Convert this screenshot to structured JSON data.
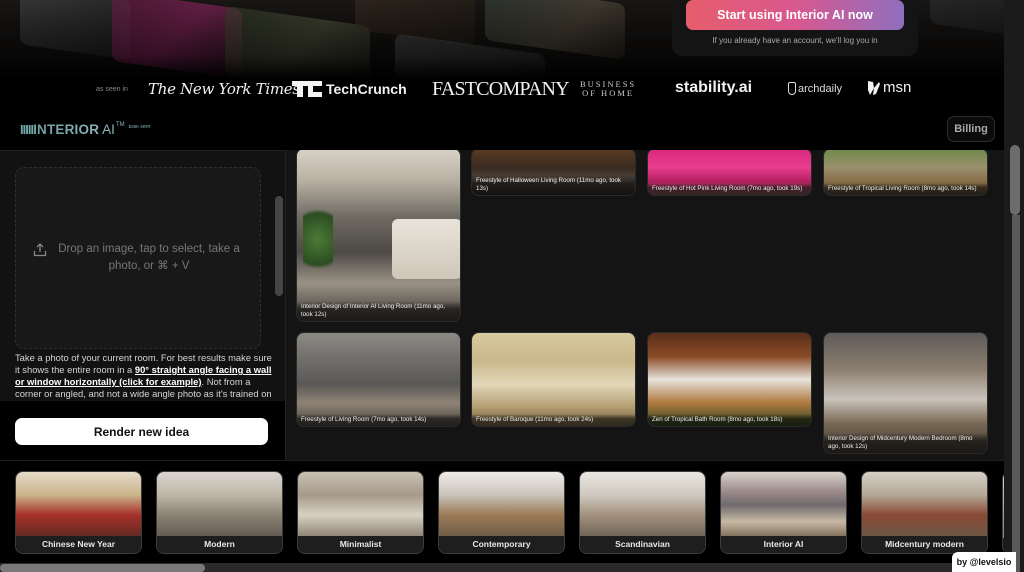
{
  "cta": {
    "button_label": "Start using Interior AI now",
    "note": "If you already have an account, we'll log you in"
  },
  "press": {
    "label": "as seen in",
    "logos": [
      "The New York Times",
      "TechCrunch",
      "FAST COMPANY",
      "BUSINESS OF HOME",
      "stability.ai",
      "archdaily",
      "msn"
    ],
    "nyt": "The New York Times",
    "techcrunch": "TechCrunch",
    "fastcompany": "FASTCOMPANY",
    "boh_line1": "BUSINESS",
    "boh_line2": "OF HOME",
    "stability": "stability.ai",
    "archdaily": "archdaily",
    "msn": "msn"
  },
  "brand": {
    "bars": "IIIII",
    "name": "INTERIOR",
    "ai": "AI",
    "tm": "TM",
    "mrr": "$38K MRR"
  },
  "header": {
    "billing_label": "Billing"
  },
  "upload": {
    "dropzone_text": "Drop an image, tap to select, take a photo, or ⌘ + V",
    "instructions_pre": "Take a photo of your current room. For best results make sure it shows the entire room in a ",
    "instructions_link": "90° straight angle facing a wall or window horizontally (click for example)",
    "instructions_post": ". Not from a corner or angled, and not a wide angle photo as it's trained on regular photos. The AI isn't great at angled pics",
    "render_label": "Render new idea"
  },
  "gallery": {
    "items": [
      {
        "caption": "Interior Design of Interior AI Living Room (11mo ago, took 12s)"
      },
      {
        "caption": "Freestyle of Halloween Living Room (11mo ago, took 13s)"
      },
      {
        "caption": "Freestyle of Hot Pink Living Room (7mo ago, took 19s)"
      },
      {
        "caption": "Freestyle of Tropical Living Room (8mo ago, took 14s)"
      },
      {
        "caption": "Freestyle of Living Room (7mo ago, took 14s)"
      },
      {
        "caption": "Freestyle of Baroque (11mo ago, took 24s)"
      },
      {
        "caption": "Zen of Tropical Bath Room (8mo ago, took 18s)"
      },
      {
        "caption": "Interior Design of Midcentury Modern Bedroom (8mo ago, took 12s)"
      }
    ]
  },
  "styles": {
    "items": [
      {
        "label": "Chinese New Year"
      },
      {
        "label": "Modern"
      },
      {
        "label": "Minimalist"
      },
      {
        "label": "Contemporary"
      },
      {
        "label": "Scandinavian"
      },
      {
        "label": "Interior AI"
      },
      {
        "label": "Midcentury modern"
      }
    ]
  },
  "credit": "by @levelsio"
}
